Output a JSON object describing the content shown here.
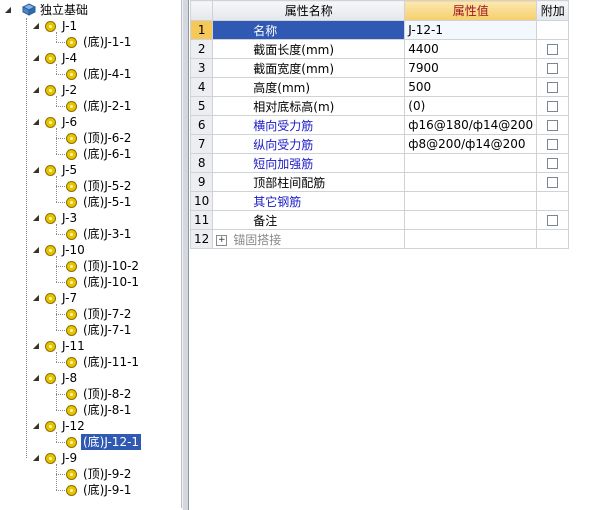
{
  "tree": {
    "root_label": "独立基础",
    "groups": [
      {
        "label": "J-1",
        "children": [
          "(底)J-1-1"
        ]
      },
      {
        "label": "J-4",
        "children": [
          "(底)J-4-1"
        ]
      },
      {
        "label": "J-2",
        "children": [
          "(底)J-2-1"
        ]
      },
      {
        "label": "J-6",
        "children": [
          "(顶)J-6-2",
          "(底)J-6-1"
        ]
      },
      {
        "label": "J-5",
        "children": [
          "(顶)J-5-2",
          "(底)J-5-1"
        ]
      },
      {
        "label": "J-3",
        "children": [
          "(底)J-3-1"
        ]
      },
      {
        "label": "J-10",
        "children": [
          "(顶)J-10-2",
          "(底)J-10-1"
        ]
      },
      {
        "label": "J-7",
        "children": [
          "(顶)J-7-2",
          "(底)J-7-1"
        ]
      },
      {
        "label": "J-11",
        "children": [
          "(底)J-11-1"
        ]
      },
      {
        "label": "J-8",
        "children": [
          "(顶)J-8-2",
          "(底)J-8-1"
        ]
      },
      {
        "label": "J-12",
        "children": [
          "(底)J-12-1"
        ]
      },
      {
        "label": "J-9",
        "children": [
          "(顶)J-9-2",
          "(底)J-9-1"
        ]
      }
    ],
    "selected": "(底)J-12-1"
  },
  "grid": {
    "headers": {
      "name": "属性名称",
      "value": "属性值",
      "extra": "附加"
    },
    "rows": [
      {
        "num": "1",
        "name": "名称",
        "value": "J-12-1",
        "style": "current",
        "checkbox": false
      },
      {
        "num": "2",
        "name": "截面长度(mm)",
        "value": "4400",
        "style": "normal",
        "checkbox": true
      },
      {
        "num": "3",
        "name": "截面宽度(mm)",
        "value": "7900",
        "style": "normal",
        "checkbox": true
      },
      {
        "num": "4",
        "name": "高度(mm)",
        "value": "500",
        "style": "normal",
        "checkbox": true
      },
      {
        "num": "5",
        "name": "相对底标高(m)",
        "value": "(0)",
        "style": "normal",
        "checkbox": true
      },
      {
        "num": "6",
        "name": "横向受力筋",
        "value": "ф16@180/ф14@200",
        "style": "blue",
        "checkbox": true
      },
      {
        "num": "7",
        "name": "纵向受力筋",
        "value": "ф8@200/ф14@200",
        "style": "blue",
        "checkbox": true
      },
      {
        "num": "8",
        "name": "短向加强筋",
        "value": "",
        "style": "blue",
        "checkbox": true
      },
      {
        "num": "9",
        "name": "顶部柱间配筋",
        "value": "",
        "style": "normal",
        "checkbox": true
      },
      {
        "num": "10",
        "name": "其它钢筋",
        "value": "",
        "style": "blue",
        "checkbox": false
      },
      {
        "num": "11",
        "name": "备注",
        "value": "",
        "style": "normal",
        "checkbox": true
      },
      {
        "num": "12",
        "name": "锚固搭接",
        "value": "",
        "style": "gray",
        "checkbox": false,
        "expander": "+"
      }
    ]
  },
  "colors": {
    "selection": "#2f59b2",
    "header_value": "#a0141e",
    "link_blue": "#1a1ac8",
    "gear": "#e9c300"
  }
}
